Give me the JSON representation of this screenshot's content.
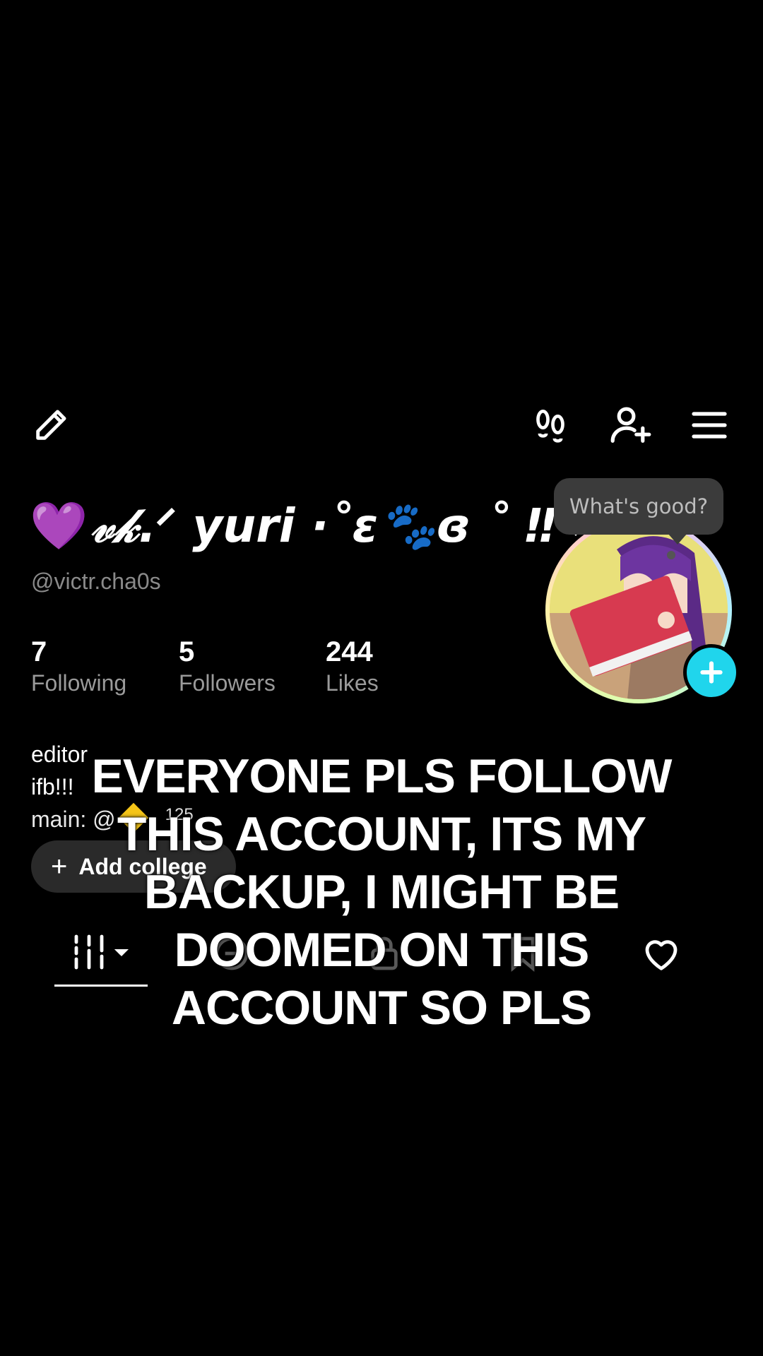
{
  "toolbar": {
    "edit_icon": "pencil-icon",
    "footprint_icon": "footprints-icon",
    "add_friend_icon": "add-user-icon",
    "menu_icon": "hamburger-menu-icon"
  },
  "profile": {
    "name_emoji": "💜",
    "display_name": "𝓋𝓀.ᐟ yuri ·˚ɛ🐾ɞ ˚ ‼",
    "username": "@victr.cha0s",
    "tooltip": "What's good?",
    "avatar_icon": "avatar-anime-girl",
    "add_avatar_icon": "plus-icon"
  },
  "stats": [
    {
      "value": "7",
      "label": "Following"
    },
    {
      "value": "5",
      "label": "Followers"
    },
    {
      "value": "244",
      "label": "Likes"
    }
  ],
  "bio": {
    "line1": "editor",
    "line2": "ifb!!!",
    "line3": "main: @",
    "line3_meta": "125"
  },
  "college_button": {
    "plus": "+",
    "label": "Add college"
  },
  "tabs": {
    "grid_icon": "grid-icon",
    "repost_icon": "repost-icon",
    "lock_icon": "lock-icon",
    "private_icon": "bookmark-icon",
    "liked_icon": "heart-icon"
  },
  "caption": {
    "line1": "EVERYONE PLS FOLLOW",
    "line2": "THIS ACCOUNT, ITS MY",
    "line3": "BACKUP, I MIGHT BE",
    "line4": "DOOMED ON THIS",
    "line5": "ACCOUNT SO PLS"
  },
  "colors": {
    "background": "#000000",
    "accent_cyan": "#20d5ec",
    "notification_red": "#fe2c55",
    "secondary_text": "#8a8a8a"
  }
}
